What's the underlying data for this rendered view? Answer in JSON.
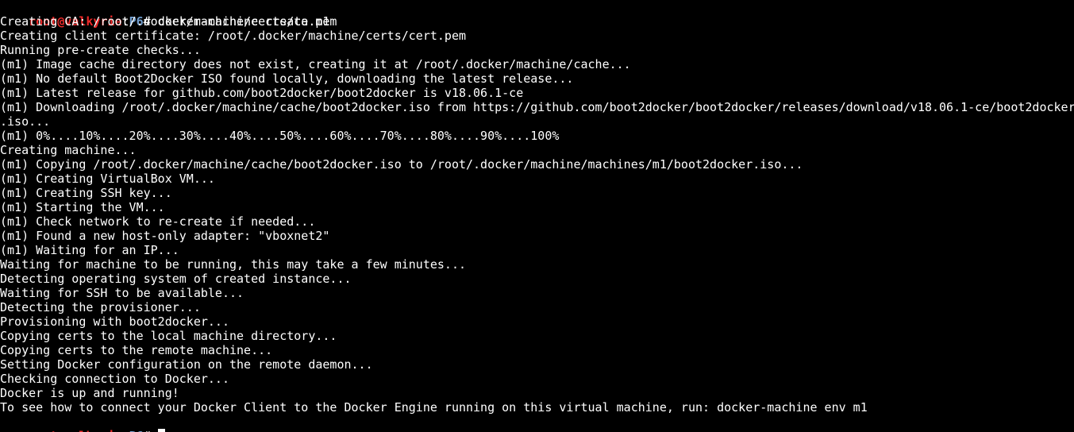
{
  "prompt": {
    "user_host": "root@valkyrie",
    "separator": ":",
    "path": "P6",
    "symbol": "# "
  },
  "command": "docker-machine create m1",
  "output": [
    "Creating CA: /root/.docker/machine/certs/ca.pem",
    "Creating client certificate: /root/.docker/machine/certs/cert.pem",
    "Running pre-create checks...",
    "(m1) Image cache directory does not exist, creating it at /root/.docker/machine/cache...",
    "(m1) No default Boot2Docker ISO found locally, downloading the latest release...",
    "(m1) Latest release for github.com/boot2docker/boot2docker is v18.06.1-ce",
    "(m1) Downloading /root/.docker/machine/cache/boot2docker.iso from https://github.com/boot2docker/boot2docker/releases/download/v18.06.1-ce/boot2docker",
    ".iso...",
    "(m1) 0%....10%....20%....30%....40%....50%....60%....70%....80%....90%....100%",
    "Creating machine...",
    "(m1) Copying /root/.docker/machine/cache/boot2docker.iso to /root/.docker/machine/machines/m1/boot2docker.iso...",
    "(m1) Creating VirtualBox VM...",
    "(m1) Creating SSH key...",
    "(m1) Starting the VM...",
    "(m1) Check network to re-create if needed...",
    "(m1) Found a new host-only adapter: \"vboxnet2\"",
    "(m1) Waiting for an IP...",
    "Waiting for machine to be running, this may take a few minutes...",
    "Detecting operating system of created instance...",
    "Waiting for SSH to be available...",
    "Detecting the provisioner...",
    "Provisioning with boot2docker...",
    "Copying certs to the local machine directory...",
    "Copying certs to the remote machine...",
    "Setting Docker configuration on the remote daemon...",
    "Checking connection to Docker...",
    "Docker is up and running!",
    "To see how to connect your Docker Client to the Docker Engine running on this virtual machine, run: docker-machine env m1"
  ],
  "colors": {
    "background": "#000000",
    "text": "#ffffff",
    "prompt_user": "#ef2929",
    "prompt_path": "#729fcf"
  }
}
